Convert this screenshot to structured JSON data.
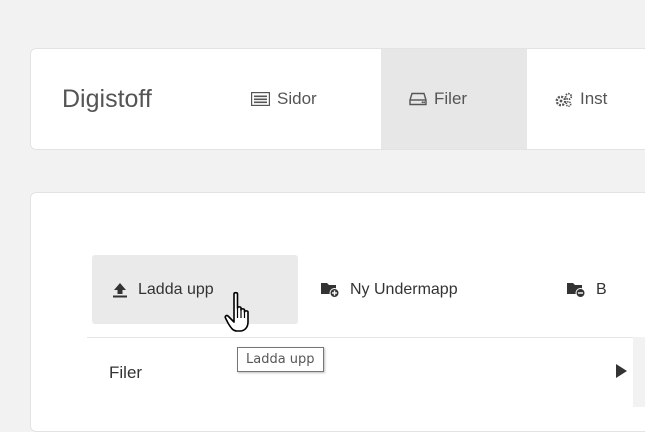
{
  "navbar": {
    "brand": "Digistoff",
    "items": [
      {
        "label": "Sidor",
        "icon": "list-alt-icon",
        "active": false
      },
      {
        "label": "Filer",
        "icon": "hdd-icon",
        "active": true
      },
      {
        "label": "Inst",
        "icon": "cogs-icon",
        "active": false
      }
    ]
  },
  "toolbar": {
    "upload_label": "Ladda upp",
    "upload_icon": "upload-icon",
    "new_folder_label": "Ny Undermapp",
    "new_folder_icon": "folder-plus-icon",
    "third_label": "B",
    "third_icon": "folder-remove-icon"
  },
  "file_list": {
    "rows": [
      {
        "label": "Filer"
      }
    ]
  },
  "tooltip": {
    "text": "Ladda upp"
  },
  "colors": {
    "active_nav_bg": "#e7e7e7",
    "upload_button_bg": "#eaeaea",
    "page_bg": "#f2f2f2"
  }
}
